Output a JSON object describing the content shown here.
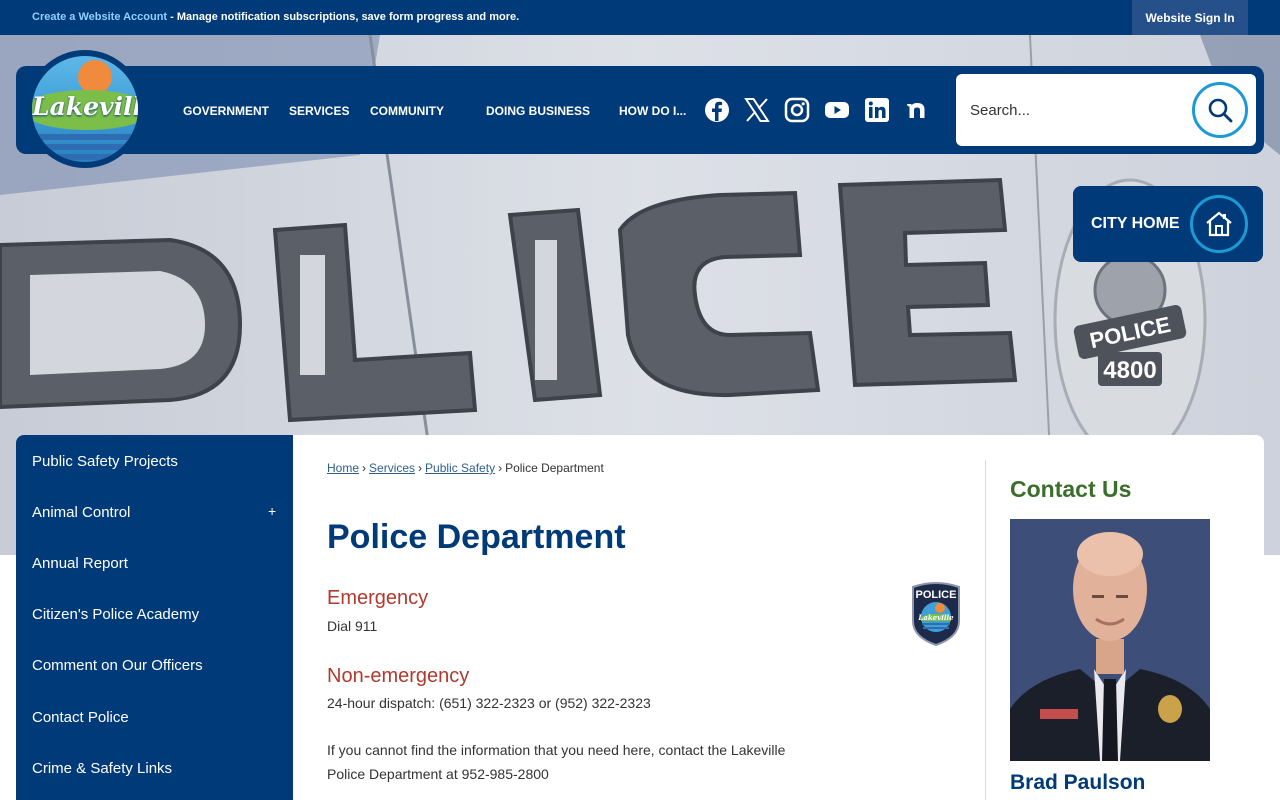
{
  "topbar": {
    "create_link": "Create a Website Account",
    "message": " - Manage notification subscriptions, save form progress and more.",
    "signin": "Website Sign In"
  },
  "logo": {
    "text": "Lakeville"
  },
  "nav": {
    "items": [
      {
        "label": "GOVERNMENT"
      },
      {
        "label": "SERVICES"
      },
      {
        "label": "COMMUNITY"
      },
      {
        "label": "DOING BUSINESS"
      },
      {
        "label": "HOW DO I..."
      }
    ]
  },
  "social": {
    "icons": [
      "facebook-icon",
      "x-icon",
      "instagram-icon",
      "youtube-icon",
      "linkedin-icon",
      "nextdoor-icon"
    ]
  },
  "search": {
    "placeholder": "Search..."
  },
  "city_home": {
    "label": "CITY HOME"
  },
  "hero": {
    "letters": "OLICE",
    "badge_word": "POLICE",
    "badge_number": "4800"
  },
  "sidebar": {
    "items": [
      {
        "label": "Public Safety Projects"
      },
      {
        "label": "Animal Control",
        "expandable": "+"
      },
      {
        "label": "Annual Report"
      },
      {
        "label": "Citizen's Police Academy"
      },
      {
        "label": "Comment on Our Officers"
      },
      {
        "label": "Contact Police"
      },
      {
        "label": "Crime & Safety Links"
      }
    ]
  },
  "breadcrumb": {
    "items": [
      "Home",
      "Services",
      "Public Safety"
    ],
    "current": "Police Department",
    "separator": "›"
  },
  "main": {
    "title": "Police Department",
    "emergency_heading": "Emergency",
    "emergency_text": "Dial 911",
    "nonemergency_heading": "Non-emergency",
    "nonemergency_text": "24-hour dispatch:  (651) 322-2323 or (952) 322-2323",
    "info_text_1": "If you cannot find the information that you need here, contact the Lakeville",
    "info_text_2": "Police Department at 952-985-2800",
    "patch_word": "POLICE",
    "patch_logo": "Lakeville"
  },
  "contact": {
    "heading": "Contact Us",
    "name": "Brad Paulson"
  },
  "colors": {
    "navy": "#003a78",
    "accent_blue": "#1c9ad6",
    "heading_red": "#b03a2e",
    "contact_green": "#3c6e2b"
  }
}
